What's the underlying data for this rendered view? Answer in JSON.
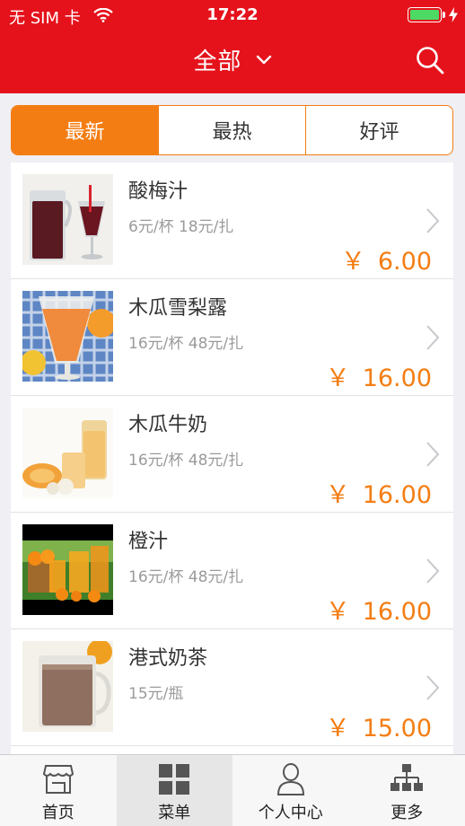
{
  "status_bar": {
    "carrier": "无 SIM 卡",
    "time": "17:22",
    "battery_level": 1.0
  },
  "nav": {
    "title": "全部",
    "dropdown_icon": "chevron-down-icon",
    "search_icon": "search-icon"
  },
  "segments": [
    {
      "label": "最新",
      "active": true
    },
    {
      "label": "最热",
      "active": false
    },
    {
      "label": "好评",
      "active": false
    }
  ],
  "items": [
    {
      "name": "酸梅汁",
      "desc": "6元/杯 18元/扎",
      "currency": "￥",
      "price": "6.00"
    },
    {
      "name": "木瓜雪梨露",
      "desc": "16元/杯  48元/扎",
      "currency": "￥",
      "price": "16.00"
    },
    {
      "name": "木瓜牛奶",
      "desc": "16元/杯 48元/扎",
      "currency": "￥",
      "price": "16.00"
    },
    {
      "name": "橙汁",
      "desc": "16元/杯 48元/扎",
      "currency": "￥",
      "price": "16.00"
    },
    {
      "name": "港式奶茶",
      "desc": "15元/瓶",
      "currency": "￥",
      "price": "15.00"
    }
  ],
  "tabs": [
    {
      "label": "首页",
      "icon": "store-icon"
    },
    {
      "label": "菜单",
      "icon": "grid-icon",
      "active": true
    },
    {
      "label": "个人中心",
      "icon": "person-icon"
    },
    {
      "label": "更多",
      "icon": "sitemap-icon"
    }
  ],
  "colors": {
    "header": "#e5121b",
    "accent": "#f47d13",
    "battery": "#4cd964"
  }
}
